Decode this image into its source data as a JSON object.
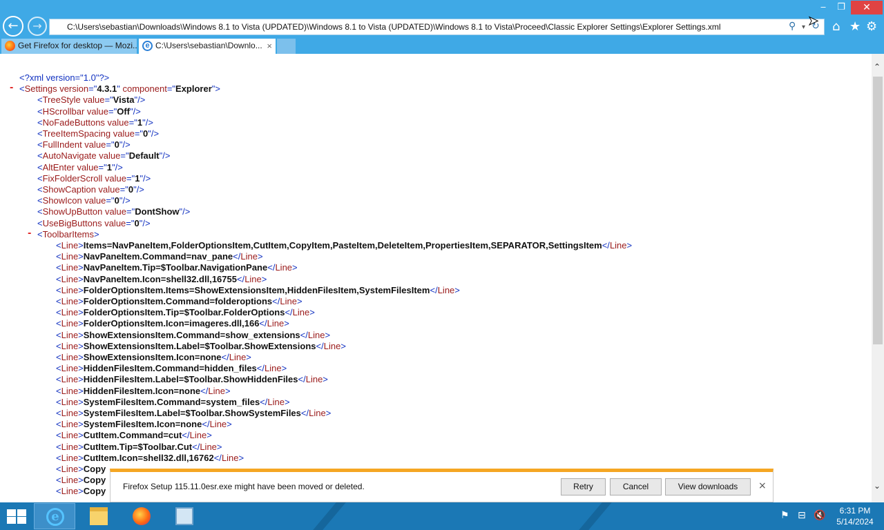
{
  "window": {
    "address": "C:\\Users\\sebastian\\Downloads\\Windows 8.1 to Vista (UPDATED)\\Windows 8.1 to Vista (UPDATED)\\Windows 8.1 to Vista\\Proceed\\Classic Explorer Settings\\Explorer Settings.xml",
    "minimize": "‒",
    "maximize": "❐",
    "close": "✕"
  },
  "tabs": [
    {
      "label": "Get Firefox for desktop — Mozi...",
      "active": false
    },
    {
      "label": "C:\\Users\\sebastian\\Downlo...",
      "active": true
    }
  ],
  "icons": {
    "back": "←",
    "forward": "→",
    "search": "⚲",
    "dropdown": "▾",
    "refresh": "↻",
    "home": "⌂",
    "favorites": "★",
    "settings": "⚙",
    "tab_close": "×",
    "scroll_up": "⌃",
    "scroll_down": "⌄",
    "ie": "e"
  },
  "xml": {
    "declaration": "<?xml version=\"1.0\"?>",
    "root": {
      "tag": "Settings",
      "attrs": [
        [
          "version",
          "4.3.1"
        ],
        [
          "component",
          "Explorer"
        ]
      ]
    },
    "settings": [
      {
        "tag": "TreeStyle",
        "value": "Vista"
      },
      {
        "tag": "HScrollbar",
        "value": "Off"
      },
      {
        "tag": "NoFadeButtons",
        "value": "1"
      },
      {
        "tag": "TreeItemSpacing",
        "value": "0"
      },
      {
        "tag": "FullIndent",
        "value": "0"
      },
      {
        "tag": "AutoNavigate",
        "value": "Default"
      },
      {
        "tag": "AltEnter",
        "value": "1"
      },
      {
        "tag": "FixFolderScroll",
        "value": "1"
      },
      {
        "tag": "ShowCaption",
        "value": "0"
      },
      {
        "tag": "ShowIcon",
        "value": "0"
      },
      {
        "tag": "ShowUpButton",
        "value": "DontShow"
      },
      {
        "tag": "UseBigButtons",
        "value": "0"
      }
    ],
    "toolbar_tag": "ToolbarItems",
    "line_tag": "Line",
    "lines": [
      "Items=NavPaneItem,FolderOptionsItem,CutItem,CopyItem,PasteItem,DeleteItem,PropertiesItem,SEPARATOR,SettingsItem",
      "NavPaneItem.Command=nav_pane",
      "NavPaneItem.Tip=$Toolbar.NavigationPane",
      "NavPaneItem.Icon=shell32.dll,16755",
      "FolderOptionsItem.Items=ShowExtensionsItem,HiddenFilesItem,SystemFilesItem",
      "FolderOptionsItem.Command=folderoptions",
      "FolderOptionsItem.Tip=$Toolbar.FolderOptions",
      "FolderOptionsItem.Icon=imageres.dll,166",
      "ShowExtensionsItem.Command=show_extensions",
      "ShowExtensionsItem.Label=$Toolbar.ShowExtensions",
      "ShowExtensionsItem.Icon=none",
      "HiddenFilesItem.Command=hidden_files",
      "HiddenFilesItem.Label=$Toolbar.ShowHiddenFiles",
      "HiddenFilesItem.Icon=none",
      "SystemFilesItem.Command=system_files",
      "SystemFilesItem.Label=$Toolbar.ShowSystemFiles",
      "SystemFilesItem.Icon=none",
      "CutItem.Command=cut",
      "CutItem.Tip=$Toolbar.Cut",
      "CutItem.Icon=shell32.dll,16762"
    ],
    "partial_lines": [
      "Copy",
      "Copy",
      "Copy"
    ],
    "toggle_symbol": "-"
  },
  "notification": {
    "message": "Firefox Setup 115.11.0esr.exe might have been moved or deleted.",
    "retry": "Retry",
    "cancel": "Cancel",
    "view_downloads": "View downloads",
    "close": "×",
    "accent_color": "#f5a623"
  },
  "taskbar": {
    "apps": [
      "internet-explorer",
      "file-explorer",
      "firefox",
      "control-panel"
    ],
    "tray_icons": [
      "flag-icon",
      "network-icon",
      "volume-muted-icon"
    ],
    "tray_glyphs": {
      "flag": "⚑",
      "network": "⊟",
      "volume": "🔇"
    },
    "time": "6:31 PM",
    "date": "5/14/2024"
  },
  "colors": {
    "titlebar": "#3fa9e6",
    "taskbar": "#1b78b5",
    "close_button": "#e04343",
    "xml_tag": "#9a1a1a",
    "xml_punctuation": "#1030c0",
    "xml_toggle": "#e02020"
  }
}
